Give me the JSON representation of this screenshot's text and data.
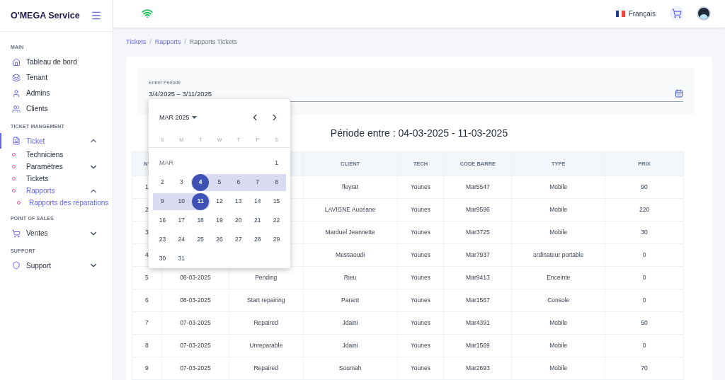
{
  "brand": "O'MEGA Service",
  "sidebar": [
    {
      "heading": "MAIN",
      "items": [
        {
          "label": "Tableau de bord",
          "selected": false
        },
        {
          "label": "Tenant",
          "selected": false
        },
        {
          "label": "Admins",
          "selected": false
        },
        {
          "label": "Clients",
          "selected": false
        }
      ]
    },
    {
      "heading": "TICKET MANGEMENT",
      "items": [
        {
          "label": "Ticket",
          "selected": true,
          "expanded": true,
          "children": [
            {
              "label": "Techniciens",
              "selected": false
            },
            {
              "label": "Paramètres",
              "selected": false,
              "expanded": false
            },
            {
              "label": "Tickets",
              "selected": false
            },
            {
              "label": "Rapports",
              "selected": true,
              "expanded": true,
              "children": [
                {
                  "label": "Rapports des réparations",
                  "selected": true
                }
              ]
            }
          ]
        }
      ]
    },
    {
      "heading": "POINT OF SALES",
      "items": [
        {
          "label": "Ventes",
          "selected": false,
          "expanded": false
        }
      ]
    },
    {
      "heading": "SUPPORT",
      "items": [
        {
          "label": "Support",
          "selected": false,
          "expanded": false
        }
      ]
    }
  ],
  "header": {
    "language": "Français"
  },
  "breadcrumb": [
    {
      "label": "Tickets",
      "kind": "link"
    },
    {
      "separator": "/",
      "label": "Rapports",
      "kind": "link"
    },
    {
      "separator": "/",
      "label": "Rapports Tickets",
      "kind": "current"
    }
  ],
  "period_field": {
    "label": "Entrer Période",
    "value": "3/4/2025 – 3/11/2025"
  },
  "calendar": {
    "month": "MAR 2025",
    "weekdays": [
      "S",
      "M",
      "T",
      "W",
      "T",
      "F",
      "S"
    ],
    "month_label": "MAR",
    "weeks": [
      [
        {
          "day": "1",
          "selected": false,
          "in_range": false
        }
      ],
      [
        {
          "day": "2",
          "selected": false,
          "in_range": false
        },
        {
          "day": "3",
          "selected": false,
          "in_range": false
        },
        {
          "day": "4",
          "selected": true,
          "in_range": true
        },
        {
          "day": "5",
          "selected": false,
          "in_range": true
        },
        {
          "day": "6",
          "selected": false,
          "in_range": true
        },
        {
          "day": "7",
          "selected": false,
          "in_range": true
        },
        {
          "day": "8",
          "selected": false,
          "in_range": true
        }
      ],
      [
        {
          "day": "9",
          "selected": false,
          "in_range": true
        },
        {
          "day": "10",
          "selected": false,
          "in_range": true
        },
        {
          "day": "11",
          "selected": true,
          "in_range": true
        },
        {
          "day": "12",
          "selected": false,
          "in_range": false
        },
        {
          "day": "13",
          "selected": false,
          "in_range": false
        },
        {
          "day": "14",
          "selected": false,
          "in_range": false
        },
        {
          "day": "15",
          "selected": false,
          "in_range": false
        }
      ],
      [
        {
          "day": "16",
          "selected": false,
          "in_range": false
        },
        {
          "day": "17",
          "selected": false,
          "in_range": false
        },
        {
          "day": "18",
          "selected": false,
          "in_range": false
        },
        {
          "day": "19",
          "selected": false,
          "in_range": false
        },
        {
          "day": "20",
          "selected": false,
          "in_range": false
        },
        {
          "day": "21",
          "selected": false,
          "in_range": false
        },
        {
          "day": "22",
          "selected": false,
          "in_range": false
        }
      ],
      [
        {
          "day": "23",
          "selected": false,
          "in_range": false
        },
        {
          "day": "24",
          "selected": false,
          "in_range": false
        },
        {
          "day": "25",
          "selected": false,
          "in_range": false
        },
        {
          "day": "26",
          "selected": false,
          "in_range": false
        },
        {
          "day": "27",
          "selected": false,
          "in_range": false
        },
        {
          "day": "28",
          "selected": false,
          "in_range": false
        },
        {
          "day": "29",
          "selected": false,
          "in_range": false
        }
      ],
      [
        {
          "day": "30",
          "selected": false,
          "in_range": false
        },
        {
          "day": "31",
          "selected": false,
          "in_range": false
        }
      ]
    ]
  },
  "title": "Période entre : 04-03-2025 - 11-03-2025",
  "table": {
    "columns": [
      "N°",
      "",
      "",
      "CLIENT",
      "TECH",
      "CODE BARRE",
      "TYPE",
      "PRIX"
    ],
    "rows": [
      [
        "1",
        "",
        "",
        "fleyrat",
        "Younes",
        "Mar5547",
        "Mobile",
        "90"
      ],
      [
        "2",
        "",
        "",
        "LAVIGNE Aucéane",
        "Younes",
        "Mar9596",
        "Mobile",
        "220"
      ],
      [
        "3",
        "",
        "",
        "Marduel Jeannette",
        "Younes",
        "Mar3725",
        "Mobile",
        "30"
      ],
      [
        "4",
        "",
        "",
        "Messaoudi",
        "Younes",
        "Mar7937",
        "ordinateur portable",
        "0"
      ],
      [
        "5",
        "08-03-2025",
        "Pending",
        "Rieu",
        "Younes",
        "Mar9413",
        "Enceinte",
        "0"
      ],
      [
        "6",
        "08-03-2025",
        "Start repairing",
        "Parant",
        "Younes",
        "Mar1567",
        "Console",
        "0"
      ],
      [
        "7",
        "07-03-2025",
        "Repaired",
        "Jdaini",
        "Younes",
        "Mar4391",
        "Mobile",
        "50"
      ],
      [
        "8",
        "07-03-2025",
        "Unreparable",
        "Jdaini",
        "Younes",
        "Mar1569",
        "Mobile",
        "0"
      ],
      [
        "9",
        "07-03-2025",
        "Repaired",
        "Soumah",
        "Younes",
        "Mar2693",
        "Mobile",
        "70"
      ]
    ]
  }
}
